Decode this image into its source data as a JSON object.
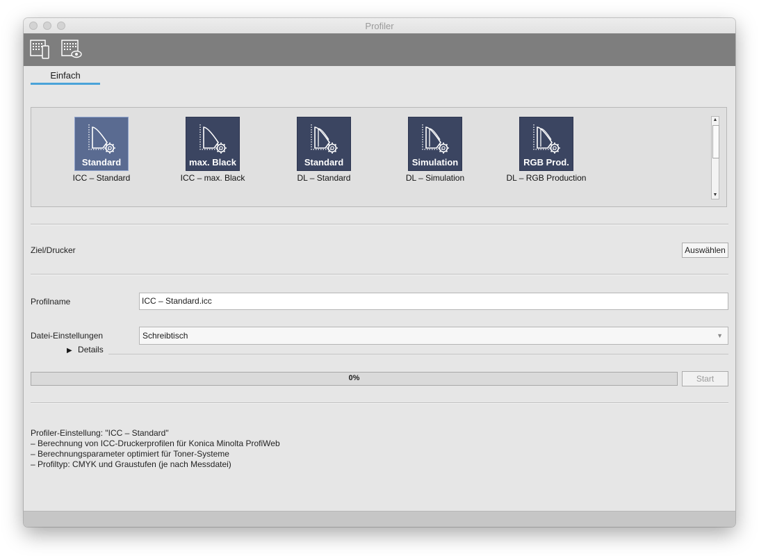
{
  "window": {
    "title": "Profiler"
  },
  "toolbar": {
    "buttons": [
      {
        "icon": "grid-device-icon"
      },
      {
        "icon": "grid-eye-icon"
      }
    ]
  },
  "tabs": [
    {
      "label": "Einfach",
      "active": true
    }
  ],
  "profiles": [
    {
      "badge": "Standard",
      "name": "ICC – Standard",
      "selected": true
    },
    {
      "badge": "max. Black",
      "name": "ICC – max. Black",
      "selected": false
    },
    {
      "badge": "Standard",
      "name": "DL – Standard",
      "selected": false
    },
    {
      "badge": "Simulation",
      "name": "DL – Simulation",
      "selected": false
    },
    {
      "badge": "RGB Prod.",
      "name": "DL – RGB Production",
      "selected": false
    }
  ],
  "target": {
    "label": "Ziel/Drucker",
    "button": "Auswählen"
  },
  "profile_name": {
    "label": "Profilname",
    "value": "ICC – Standard.icc"
  },
  "file_settings": {
    "label": "Datei-Einstellungen",
    "value": "Schreibtisch",
    "details": "Details"
  },
  "progress": {
    "text": "0%",
    "value": 0,
    "start_button": "Start"
  },
  "info": {
    "lines": [
      "Profiler-Einstellung: \"ICC – Standard\"",
      "– Berechnung von ICC-Druckerprofilen für Konica Minolta ProfiWeb",
      "– Berechnungsparameter optimiert für Toner-Systeme",
      "– Profiltyp: CMYK und Graustufen (je nach Messdatei)"
    ]
  },
  "colors": {
    "accent": "#4aa3d9",
    "tile": "#3b4561",
    "tile_selected": "#5a6b91",
    "toolbar": "#7e7e7e"
  }
}
